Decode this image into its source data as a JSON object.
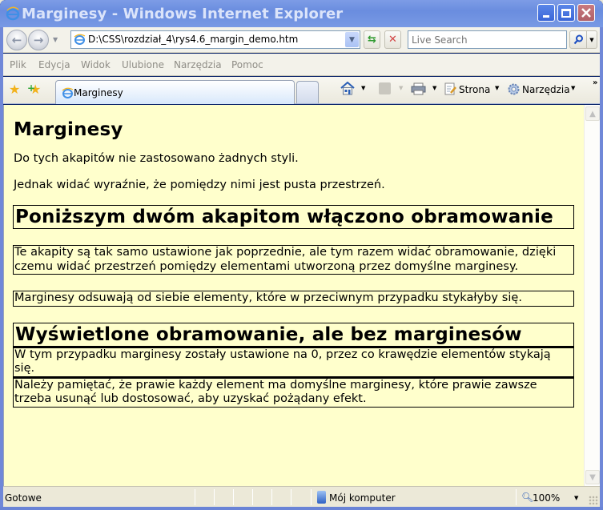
{
  "window": {
    "title": "Marginesy - Windows Internet Explorer",
    "controls": {
      "minimize": "minimize",
      "maximize": "maximize",
      "close": "close"
    }
  },
  "addressbar": {
    "url": "D:\\CSS\\rozdział_4\\rys4.6_margin_demo.htm",
    "search_placeholder": "Live Search",
    "back_glyph": "←",
    "forward_glyph": "→"
  },
  "menubar": {
    "items": [
      "Plik",
      "Edycja",
      "Widok",
      "Ulubione",
      "Narzędzia",
      "Pomoc"
    ]
  },
  "toolbar": {
    "tab_label": "Marginesy",
    "page_label": "Strona",
    "tools_label": "Narzędzia",
    "overflow": "»"
  },
  "page": {
    "h1": "Marginesy",
    "p1": "Do tych akapitów nie zastosowano żadnych styli.",
    "p2": "Jednak widać wyraźnie, że pomiędzy nimi jest pusta przestrzeń.",
    "h2_bordered": "Poniższym dwóm akapitom włączono obramowanie",
    "p3": "Te akapity są tak samo ustawione jak poprzednie, ale tym razem widać obramowanie, dzięki czemu widać przestrzeń pomiędzy elementami utworzoną przez domyślne marginesy.",
    "p4": "Marginesy odsuwają od siebie elementy, które w przeciwnym przypadku stykałyby się.",
    "h2_nomargin": "Wyświetlone obramowanie, ale bez marginesów",
    "p5": "W tym przypadku marginesy zostały ustawione na 0, przez co krawędzie elementów stykają się.",
    "p6": "Należy pamiętać, że prawie każdy element ma domyślne marginesy, które prawie zawsze trzeba usunąć lub dostosować, aby uzyskać pożądany efekt."
  },
  "statusbar": {
    "status": "Gotowe",
    "zone": "Mój komputer",
    "zoom": "100%"
  },
  "colors": {
    "page_background": "#ffffcc",
    "titlebar": "#7899e4"
  }
}
